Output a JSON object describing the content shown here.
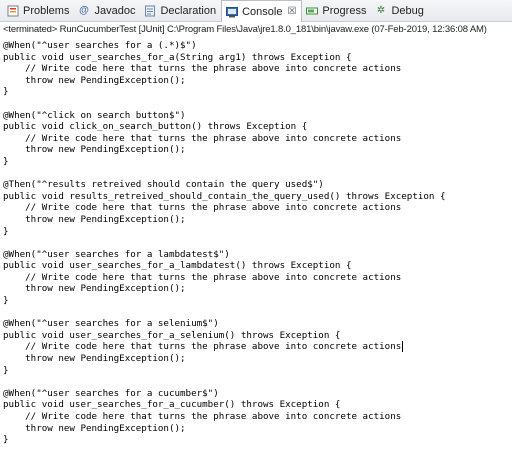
{
  "tabs": [
    {
      "label": "Problems",
      "icon": "problems-icon",
      "active": false
    },
    {
      "label": "Javadoc",
      "icon": "javadoc-icon",
      "active": false
    },
    {
      "label": "Declaration",
      "icon": "declaration-icon",
      "active": false
    },
    {
      "label": "Console",
      "icon": "console-icon",
      "active": true
    },
    {
      "label": "Progress",
      "icon": "progress-icon",
      "active": false
    },
    {
      "label": "Debug",
      "icon": "debug-icon",
      "active": false
    }
  ],
  "status": "<terminated> RunCucumberTest [JUnit] C:\\Program Files\\Java\\jre1.8.0_181\\bin\\javaw.exe (07-Feb-2019, 12:36:08 AM)",
  "console_lines": [
    "@When(\"^user searches for a (.*)$\")",
    "public void user_searches_for_a(String arg1) throws Exception {",
    "    // Write code here that turns the phrase above into concrete actions",
    "    throw new PendingException();",
    "}",
    "",
    "@When(\"^click on search button$\")",
    "public void click_on_search_button() throws Exception {",
    "    // Write code here that turns the phrase above into concrete actions",
    "    throw new PendingException();",
    "}",
    "",
    "@Then(\"^results retreived should contain the query used$\")",
    "public void results_retreived_should_contain_the_query_used() throws Exception {",
    "    // Write code here that turns the phrase above into concrete actions",
    "    throw new PendingException();",
    "}",
    "",
    "@When(\"^user searches for a lambdatest$\")",
    "public void user_searches_for_a_lambdatest() throws Exception {",
    "    // Write code here that turns the phrase above into concrete actions",
    "    throw new PendingException();",
    "}",
    "",
    "@When(\"^user searches for a selenium$\")",
    "public void user_searches_for_a_selenium() throws Exception {",
    "    // Write code here that turns the phrase above into concrete actions",
    "    throw new PendingException();",
    "}",
    "",
    "@When(\"^user searches for a cucumber$\")",
    "public void user_searches_for_a_cucumber() throws Exception {",
    "    // Write code here that turns the phrase above into concrete actions",
    "    throw new PendingException();",
    "}"
  ],
  "caret_line": 26
}
